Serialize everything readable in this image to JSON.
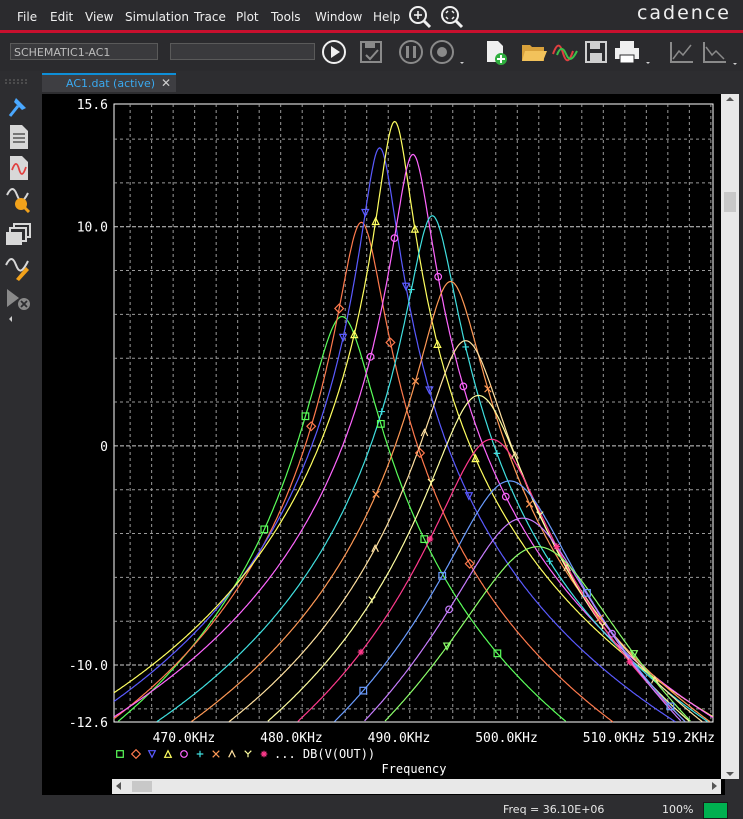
{
  "menubar": {
    "items": [
      "File",
      "Edit",
      "View",
      "Simulation",
      "Trace",
      "Plot",
      "Tools",
      "Window",
      "Help"
    ],
    "brand": "cadence"
  },
  "toolbar": {
    "profile_field": "SCHEMATIC1-AC1",
    "second_field": ""
  },
  "tab": {
    "label": "AC1.dat (active)",
    "close": "✕"
  },
  "left_toolbar_icons": [
    "toggle-cursor-icon",
    "view-netlist-icon",
    "view-waveform-icon",
    "probe-zoom-icon",
    "multi-window-icon",
    "markers-icon",
    "analog-digital-icon"
  ],
  "status": {
    "freq": "Freq = 36.10E+06",
    "zoom": "100%",
    "indicator_color": "#00b050"
  },
  "chart_data": {
    "type": "line",
    "title": "",
    "xlabel": "Frequency",
    "ylabel": "",
    "xlim": [
      463.5,
      519.2
    ],
    "ylim": [
      -12.6,
      15.6
    ],
    "x_tick_labels": [
      "470.0KHz",
      "480.0KHz",
      "490.0KHz",
      "500.0KHz",
      "510.0KHz",
      "519.2KHz"
    ],
    "x_tick_values": [
      470,
      480,
      490,
      500,
      510,
      519.2
    ],
    "y_tick_labels": [
      "15.6",
      "10.0",
      "0",
      "-10.0",
      "-12.6"
    ],
    "y_tick_values": [
      15.6,
      10,
      0,
      -10,
      -12.6
    ],
    "grid": true,
    "legend_text": "... DB(V(OUT))",
    "legend_markers": [
      "square",
      "diamond",
      "triangle-down",
      "triangle-up",
      "circle",
      "plus",
      "x",
      "lambda",
      "y",
      "asterisk"
    ],
    "series": [
      {
        "color": "#5aff5a",
        "marker": "square",
        "f0": 484.7,
        "peak": 5.9,
        "hw": 2.5
      },
      {
        "color": "#ff7a4d",
        "marker": "diamond",
        "f0": 486.5,
        "peak": 10.2,
        "hw": 1.7
      },
      {
        "color": "#5a5aff",
        "marker": "triangle-down",
        "f0": 488.2,
        "peak": 13.6,
        "hw": 1.35
      },
      {
        "color": "#ffff60",
        "marker": "triangle-up",
        "f0": 489.6,
        "peak": 14.8,
        "hw": 1.3
      },
      {
        "color": "#ff66ff",
        "marker": "circle",
        "f0": 491.3,
        "peak": 13.3,
        "hw": 1.45
      },
      {
        "color": "#40e0e0",
        "marker": "plus",
        "f0": 493.1,
        "peak": 10.5,
        "hw": 1.8
      },
      {
        "color": "#ff9955",
        "marker": "x",
        "f0": 494.8,
        "peak": 7.5,
        "hw": 2.4
      },
      {
        "color": "#ffe0a0",
        "marker": "lambda",
        "f0": 496.2,
        "peak": 4.8,
        "hw": 3.0
      },
      {
        "color": "#ffffa0",
        "marker": "y",
        "f0": 497.4,
        "peak": 2.3,
        "hw": 3.6
      },
      {
        "color": "#ff3a8c",
        "marker": "asterisk",
        "f0": 498.6,
        "peak": 0.3,
        "hw": 4.2
      },
      {
        "color": "#6a9cff",
        "marker": "square",
        "f0": 500.3,
        "peak": -1.6,
        "hw": 4.8
      },
      {
        "color": "#c77dff",
        "marker": "circle",
        "f0": 501.5,
        "peak": -3.3,
        "hw": 5.4
      },
      {
        "color": "#8cff6a",
        "marker": "triangle-down",
        "f0": 502.9,
        "peak": -4.6,
        "hw": 6.2
      }
    ]
  }
}
